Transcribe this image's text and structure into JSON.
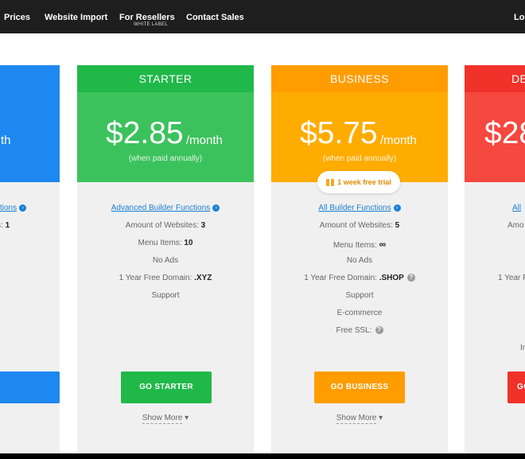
{
  "nav": {
    "items": [
      {
        "label": "Prices"
      },
      {
        "label": "Website Import"
      },
      {
        "label": "For Resellers",
        "sub": "WHITE LABEL"
      },
      {
        "label": "Contact Sales"
      },
      {
        "label": "Log"
      }
    ]
  },
  "plans": {
    "left": {
      "price_suffix": "th",
      "link": "ctions",
      "websites_label": "s:",
      "websites_value": "1",
      "color": "#1e88f0"
    },
    "starter": {
      "name": "STARTER",
      "price": "$2.85",
      "period": "/month",
      "note": "(when paid annually)",
      "link": "Advanced Builder Functions",
      "websites_label": "Amount of Websites:",
      "websites_value": "3",
      "menu_label": "Menu Items:",
      "menu_value": "10",
      "no_ads": "No Ads",
      "domain_label": "1 Year Free Domain:",
      "domain_value": ".XYZ",
      "support": "Support",
      "button": "GO STARTER",
      "show_more": "Show More",
      "color": "#21b84a"
    },
    "business": {
      "name": "BUSINESS",
      "price": "$5.75",
      "period": "/month",
      "note": "(when paid annually)",
      "trial": "1 week free trial",
      "link": "All Builder Functions",
      "websites_label": "Amount of Websites:",
      "websites_value": "5",
      "menu_label": "Menu Items:",
      "menu_value": "∞",
      "no_ads": "No Ads",
      "domain_label": "1 Year Free Domain:",
      "domain_value": ".SHOP",
      "support": "Support",
      "ecommerce": "E-commerce",
      "ssl_label": "Free SSL:",
      "button": "GO BUSINESS",
      "show_more": "Show More",
      "color": "#ff9c00"
    },
    "right": {
      "name": "DE",
      "price": "$28",
      "link": "All",
      "websites_label": "Amo",
      "domain_label": "1 Year F",
      "extra": "In",
      "button": "GO",
      "color": "#f0322a"
    }
  }
}
